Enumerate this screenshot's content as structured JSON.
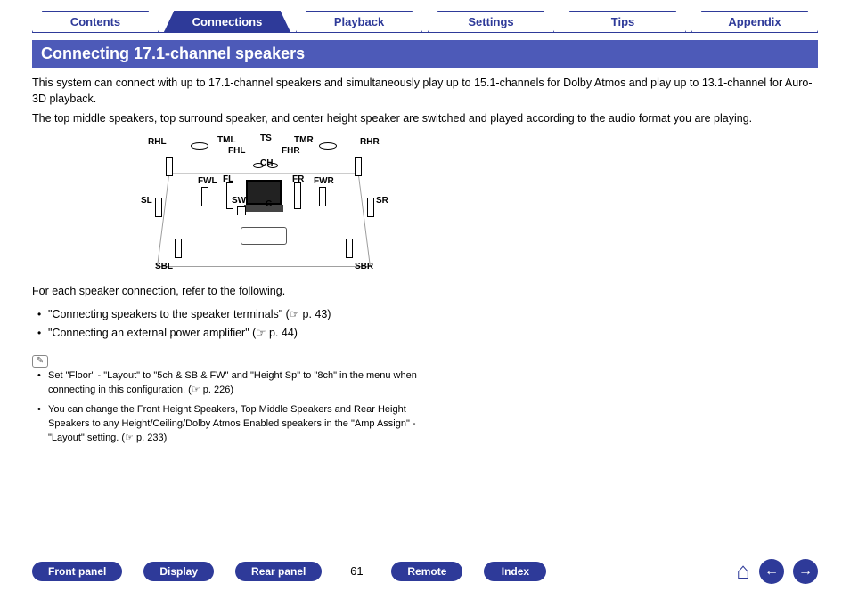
{
  "topTabs": {
    "items": [
      {
        "label": "Contents"
      },
      {
        "label": "Connections"
      },
      {
        "label": "Playback"
      },
      {
        "label": "Settings"
      },
      {
        "label": "Tips"
      },
      {
        "label": "Appendix"
      }
    ],
    "activeIndex": 1
  },
  "section": {
    "title": "Connecting 17.1-channel speakers",
    "p1": "This system can connect with up to 17.1-channel speakers and simultaneously play up to 15.1-channels for Dolby Atmos and play up to 13.1-channel for Auro-3D playback.",
    "p2": "The top middle speakers, top surround speaker, and center height speaker are switched and played according to the audio format you are playing."
  },
  "diagram": {
    "labels": {
      "RHL": "RHL",
      "TML": "TML",
      "TS": "TS",
      "TMR": "TMR",
      "RHR": "RHR",
      "FHL": "FHL",
      "FHR": "FHR",
      "CH": "CH",
      "FWL": "FWL",
      "FL": "FL",
      "FR": "FR",
      "FWR": "FWR",
      "SL": "SL",
      "SW": "SW",
      "C": "C",
      "SR": "SR",
      "SBL": "SBL",
      "SBR": "SBR"
    }
  },
  "refIntro": "For each speaker connection, refer to the following.",
  "refs": [
    {
      "text": "\"Connecting speakers to the speaker terminals\" (☞ p. 43)"
    },
    {
      "text": "\"Connecting an external power amplifier\" (☞ p. 44)"
    }
  ],
  "pencil": "✎",
  "notes": [
    {
      "text": "Set \"Floor\" - \"Layout\" to \"5ch & SB & FW\" and \"Height Sp\" to \"8ch\" in the menu when connecting in this configuration.  (☞ p. 226)"
    },
    {
      "text": "You can change the Front Height Speakers, Top Middle Speakers and Rear Height Speakers to any Height/Ceiling/Dolby Atmos Enabled speakers in the \"Amp Assign\" - \"Layout\" setting.  (☞ p. 233)"
    }
  ],
  "footer": {
    "buttons": {
      "frontPanel": "Front panel",
      "display": "Display",
      "rearPanel": "Rear panel",
      "remote": "Remote",
      "index": "Index"
    },
    "pageNum": "61",
    "icons": {
      "home": "⌂",
      "prev": "←",
      "next": "→"
    }
  }
}
